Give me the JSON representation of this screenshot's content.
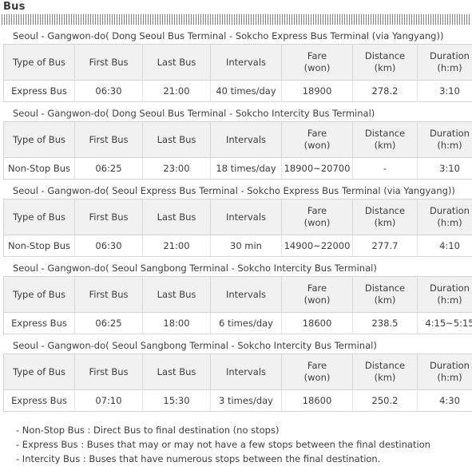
{
  "header": {
    "title": "Bus",
    "divider_icon": "striped-divider"
  },
  "columns": [
    "Type of Bus",
    "First Bus",
    "Last Bus",
    "Intervals",
    "Fare\n(won)",
    "Distance\n(km)",
    "Duration\n(h:m)"
  ],
  "column_labels": {
    "type_of_bus": "Type of Bus",
    "first_bus": "First Bus",
    "last_bus": "Last Bus",
    "intervals": "Intervals",
    "fare_main": "Fare",
    "fare_unit": "(won)",
    "distance_main": "Distance",
    "distance_unit": "(km)",
    "duration_main": "Duration",
    "duration_unit": "(h:m)"
  },
  "sections": [
    {
      "caption": "Seoul - Gangwon-do( Dong Seoul Bus Terminal - Sokcho Express Bus Terminal (via Yangyang))",
      "row": {
        "type_of_bus": "Express Bus",
        "first_bus": "06:30",
        "last_bus": "21:00",
        "intervals": "40 times/day",
        "fare": "18900",
        "distance": "278.2",
        "duration": "3:10"
      }
    },
    {
      "caption": "Seoul - Gangwon-do( Dong Seoul Bus Terminal - Sokcho Intercity Bus Terminal)",
      "row": {
        "type_of_bus": "Non-Stop Bus",
        "first_bus": "06:25",
        "last_bus": "23:00",
        "intervals": "18 times/day",
        "fare": "18900~20700",
        "distance": "-",
        "duration": "3:10"
      }
    },
    {
      "caption": "Seoul - Gangwon-do( Seoul Express Bus Terminal - Sokcho Express Bus Terminal (via Yangyang))",
      "row": {
        "type_of_bus": "Non-Stop Bus",
        "first_bus": "06:30",
        "last_bus": "21:00",
        "intervals": "30 min",
        "fare": "14900~22000",
        "distance": "277.7",
        "duration": "4:10"
      }
    },
    {
      "caption": "Seoul - Gangwon-do( Seoul Sangbong Terminal - Sokcho Intercity Bus Terminal)",
      "row": {
        "type_of_bus": "Express Bus",
        "first_bus": "06:25",
        "last_bus": "18:00",
        "intervals": "6 times/day",
        "fare": "18600",
        "distance": "238.5",
        "duration": "4:15~5:15"
      }
    },
    {
      "caption": "Seoul - Gangwon-do( Seoul Sangbong Terminal - Sokcho Intercity Bus Terminal)",
      "row": {
        "type_of_bus": "Express Bus",
        "first_bus": "07:10",
        "last_bus": "15:30",
        "intervals": "3 times/day",
        "fare": "18600",
        "distance": "250.2",
        "duration": "4:30"
      }
    }
  ],
  "notes": [
    "- Non-Stop Bus : Direct Bus to final destination (no stops)",
    "- Express Bus : Buses that may or may not have a few stops between the final destination",
    "- Intercity Bus : Buses that have numerous stops between the final destination."
  ],
  "colors": {
    "header_bg": "#f1f1f1",
    "border": "#d4d4d4",
    "text": "#3d3d3d",
    "stripe": "#808080"
  }
}
